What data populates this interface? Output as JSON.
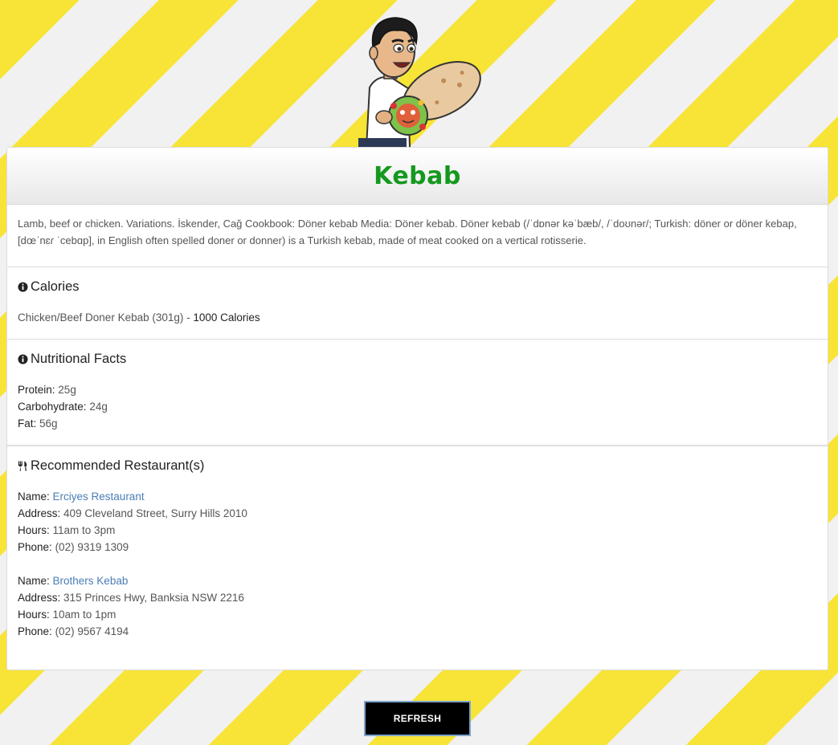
{
  "title": "Kebab",
  "description": "Lamb, beef or chicken. Variations. İskender, Cağ Cookbook: Döner kebab Media: Döner kebab. Döner kebab (/ˈdɒnər kəˈbæb/, /ˈdoʊnər/; Turkish: döner or döner kebap, [dœˈnɛɾ ˈcebɑp], in English often spelled doner or donner) is a Turkish kebab, made of meat cooked on a vertical rotisserie.",
  "calories": {
    "heading": "Calories",
    "item": "Chicken/Beef Doner Kebab (301g) - ",
    "value": "1000 Calories"
  },
  "nutrition": {
    "heading": "Nutritional Facts",
    "protein_label": "Protein:",
    "protein": "25g",
    "carb_label": "Carbohydrate:",
    "carb": "24g",
    "fat_label": "Fat:",
    "fat": "56g"
  },
  "restaurants": {
    "heading": "Recommended Restaurant(s)",
    "name_label": "Name:",
    "address_label": "Address:",
    "hours_label": "Hours:",
    "phone_label": "Phone:",
    "items": [
      {
        "name": "Erciyes Restaurant",
        "address": "409 Cleveland Street, Surry Hills 2010",
        "hours": "11am to 3pm",
        "phone": "(02) 9319 1309"
      },
      {
        "name": "Brothers Kebab",
        "address": "315 Princes Hwy, Banksia NSW 2216",
        "hours": "10am to 1pm",
        "phone": "(02) 9567 4194"
      }
    ]
  },
  "refresh_label": "REFRESH",
  "colors": {
    "title": "#14991e",
    "link": "#4a7db5",
    "stripe_yellow": "#f8e436",
    "stripe_white": "#f1f1f1"
  },
  "icons": [
    "mascot-avatar",
    "info-circle-icon",
    "cutlery-icon"
  ]
}
